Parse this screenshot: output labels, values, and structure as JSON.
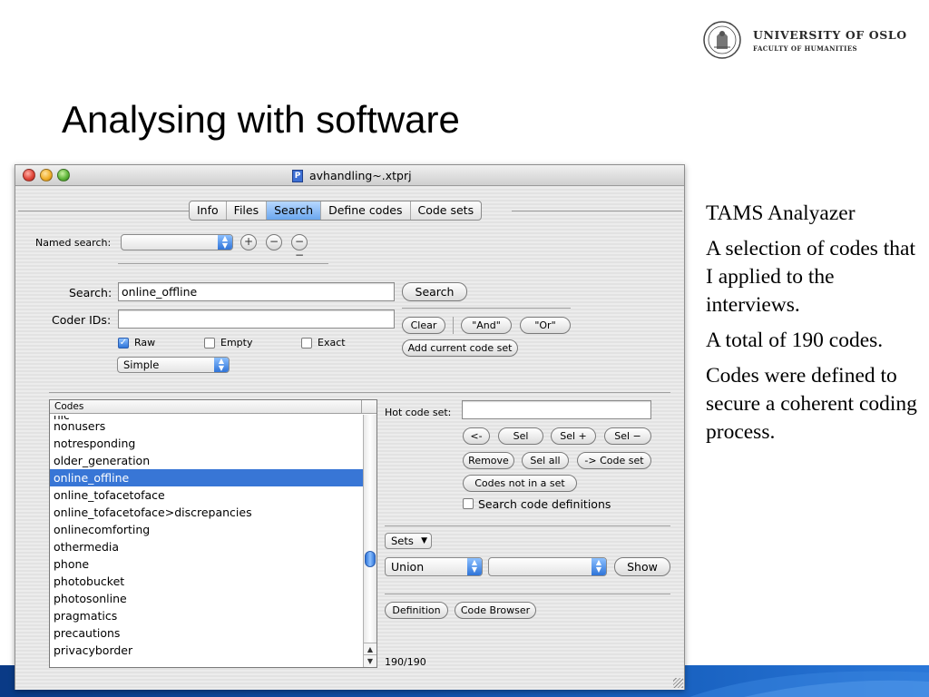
{
  "branding": {
    "university": "UNIVERSITY OF OSLO",
    "faculty": "FACULTY OF HUMANITIES"
  },
  "slide": {
    "title": "Analysing with software",
    "notes": [
      "TAMS Analyazer",
      "A selection of codes that I applied to the interviews.",
      "A total of 190 codes.",
      "Codes were defined to secure a coherent coding process."
    ]
  },
  "window": {
    "title": "avhandling~.xtprj",
    "doc_icon": "document-icon",
    "tabs": [
      {
        "label": "Info",
        "active": false
      },
      {
        "label": "Files",
        "active": false
      },
      {
        "label": "Search",
        "active": true
      },
      {
        "label": "Define codes",
        "active": false
      },
      {
        "label": "Code sets",
        "active": false
      }
    ]
  },
  "search_panel": {
    "named_search_label": "Named search:",
    "named_search_value": "",
    "named_search_buttons": [
      "+",
      "−",
      "−−"
    ],
    "search_label": "Search:",
    "search_value": "online_offline",
    "search_button": "Search",
    "coder_ids_label": "Coder IDs:",
    "coder_ids_value": "",
    "clear_button": "Clear",
    "and_button": "\"And\"",
    "or_button": "\"Or\"",
    "add_code_set_button": "Add current code set",
    "raw": {
      "label": "Raw",
      "checked": true
    },
    "empty": {
      "label": "Empty",
      "checked": false
    },
    "exact": {
      "label": "Exact",
      "checked": false
    },
    "mode_value": "Simple"
  },
  "codes_list": {
    "header": "Codes",
    "partial_top": "nic",
    "items": [
      {
        "label": "nonusers",
        "selected": false
      },
      {
        "label": "notresponding",
        "selected": false
      },
      {
        "label": "older_generation",
        "selected": false
      },
      {
        "label": "online_offline",
        "selected": true
      },
      {
        "label": "online_tofacetoface",
        "selected": false
      },
      {
        "label": "online_tofacetoface>discrepancies",
        "selected": false
      },
      {
        "label": "onlinecomforting",
        "selected": false
      },
      {
        "label": "othermedia",
        "selected": false
      },
      {
        "label": "phone",
        "selected": false
      },
      {
        "label": "photobucket",
        "selected": false
      },
      {
        "label": "photosonline",
        "selected": false
      },
      {
        "label": "pragmatics",
        "selected": false
      },
      {
        "label": "precautions",
        "selected": false
      },
      {
        "label": "privacyborder",
        "selected": false
      }
    ]
  },
  "hot_code_panel": {
    "hot_code_set_label": "Hot code set:",
    "hot_code_set_value": "",
    "back_button": "<-",
    "sel_button": "Sel",
    "sel_plus_button": "Sel +",
    "sel_minus_button": "Sel −",
    "remove_button": "Remove",
    "sel_all_button": "Sel all",
    "to_code_set_button": "-> Code set",
    "codes_not_in_set_button": "Codes not in a set",
    "search_defs": {
      "label": "Search code definitions",
      "checked": false
    },
    "sets_button": "Sets",
    "union_value": "Union",
    "second_popup_value": "",
    "show_button": "Show",
    "definition_button": "Definition",
    "code_browser_button": "Code Browser",
    "count": "190/190"
  },
  "colors": {
    "selection": "#3876d6",
    "tab_active": "#6aa6ee",
    "band": "#1150a8"
  }
}
